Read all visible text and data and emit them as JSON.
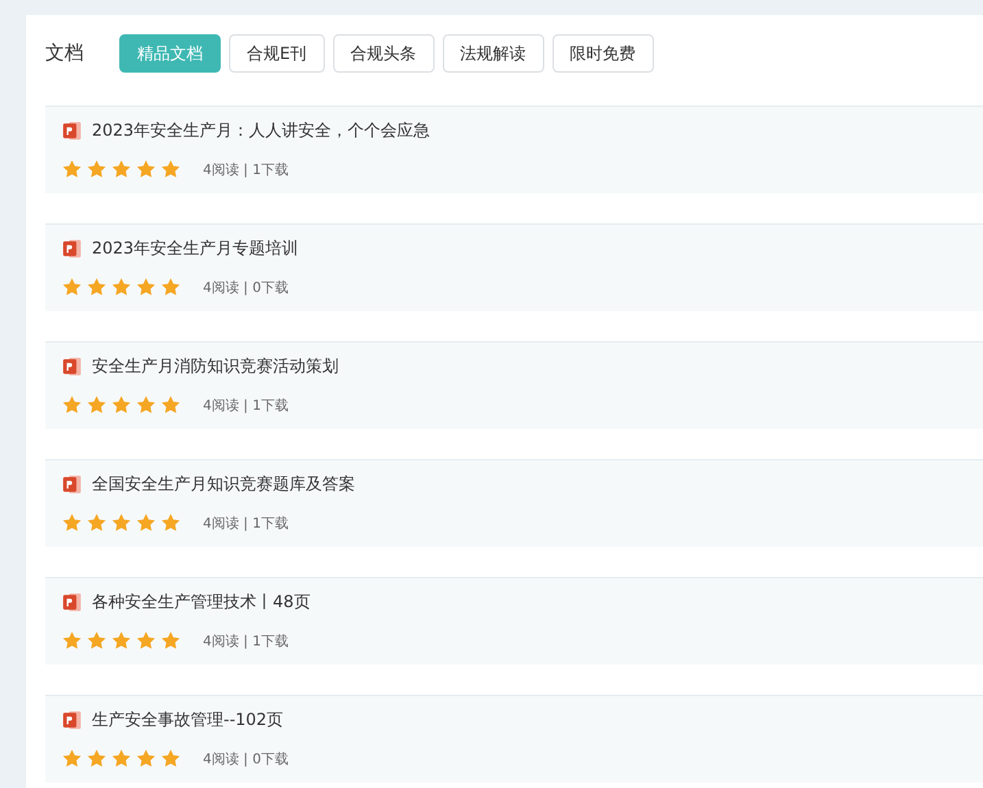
{
  "section_label": "文档",
  "tabs": [
    {
      "label": "精品文档",
      "selected": true
    },
    {
      "label": "合规E刊",
      "selected": false
    },
    {
      "label": "合规头条",
      "selected": false
    },
    {
      "label": "法规解读",
      "selected": false
    },
    {
      "label": "限时免费",
      "selected": false
    }
  ],
  "documents": [
    {
      "title": "2023年安全生产月：人人讲安全，个个会应急",
      "stars": 5,
      "meta": "4阅读 | 1下载"
    },
    {
      "title": "2023年安全生产月专题培训",
      "stars": 5,
      "meta": "4阅读 | 0下载"
    },
    {
      "title": "安全生产月消防知识竞赛活动策划",
      "stars": 5,
      "meta": "4阅读 | 1下载"
    },
    {
      "title": "全国安全生产月知识竞赛题库及答案",
      "stars": 5,
      "meta": "4阅读 | 1下载"
    },
    {
      "title": "各种安全生产管理技术丨48页",
      "stars": 5,
      "meta": "4阅读 | 1下载"
    },
    {
      "title": "生产安全事故管理--102页",
      "stars": 5,
      "meta": "4阅读 | 0下载"
    }
  ]
}
